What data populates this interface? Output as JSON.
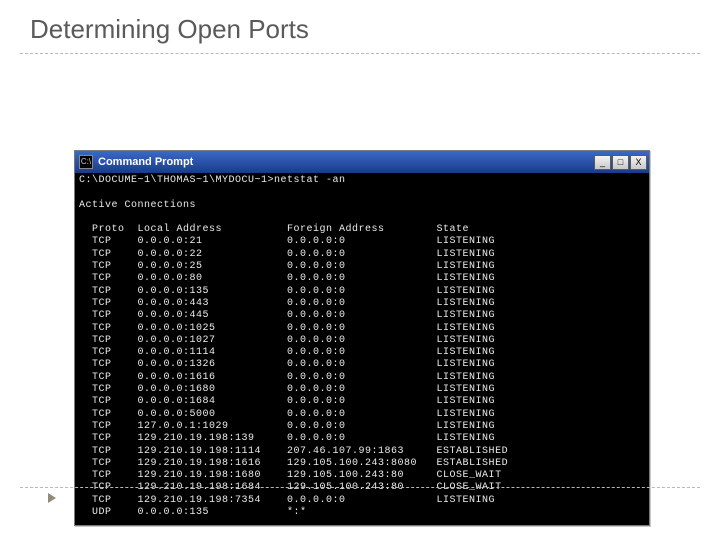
{
  "slide": {
    "title": "Determining Open Ports"
  },
  "window": {
    "title": "Command Prompt",
    "icon_text": "C:\\",
    "min_label": "_",
    "max_label": "□",
    "close_label": "X"
  },
  "terminal": {
    "prompt": "C:\\DOCUME~1\\THOMAS~1\\MYDOCU~1>netstat -an",
    "section_header": "Active Connections",
    "columns": {
      "proto": "Proto",
      "local": "Local Address",
      "foreign": "Foreign Address",
      "state": "State"
    },
    "rows": [
      {
        "proto": "TCP",
        "local": "0.0.0.0:21",
        "foreign": "0.0.0.0:0",
        "state": "LISTENING"
      },
      {
        "proto": "TCP",
        "local": "0.0.0.0:22",
        "foreign": "0.0.0.0:0",
        "state": "LISTENING"
      },
      {
        "proto": "TCP",
        "local": "0.0.0.0:25",
        "foreign": "0.0.0.0:0",
        "state": "LISTENING"
      },
      {
        "proto": "TCP",
        "local": "0.0.0.0:80",
        "foreign": "0.0.0.0:0",
        "state": "LISTENING"
      },
      {
        "proto": "TCP",
        "local": "0.0.0.0:135",
        "foreign": "0.0.0.0:0",
        "state": "LISTENING"
      },
      {
        "proto": "TCP",
        "local": "0.0.0.0:443",
        "foreign": "0.0.0.0:0",
        "state": "LISTENING"
      },
      {
        "proto": "TCP",
        "local": "0.0.0.0:445",
        "foreign": "0.0.0.0:0",
        "state": "LISTENING"
      },
      {
        "proto": "TCP",
        "local": "0.0.0.0:1025",
        "foreign": "0.0.0.0:0",
        "state": "LISTENING"
      },
      {
        "proto": "TCP",
        "local": "0.0.0.0:1027",
        "foreign": "0.0.0.0:0",
        "state": "LISTENING"
      },
      {
        "proto": "TCP",
        "local": "0.0.0.0:1114",
        "foreign": "0.0.0.0:0",
        "state": "LISTENING"
      },
      {
        "proto": "TCP",
        "local": "0.0.0.0:1326",
        "foreign": "0.0.0.0:0",
        "state": "LISTENING"
      },
      {
        "proto": "TCP",
        "local": "0.0.0.0:1616",
        "foreign": "0.0.0.0:0",
        "state": "LISTENING"
      },
      {
        "proto": "TCP",
        "local": "0.0.0.0:1680",
        "foreign": "0.0.0.0:0",
        "state": "LISTENING"
      },
      {
        "proto": "TCP",
        "local": "0.0.0.0:1684",
        "foreign": "0.0.0.0:0",
        "state": "LISTENING"
      },
      {
        "proto": "TCP",
        "local": "0.0.0.0:5000",
        "foreign": "0.0.0.0:0",
        "state": "LISTENING"
      },
      {
        "proto": "TCP",
        "local": "127.0.0.1:1029",
        "foreign": "0.0.0.0:0",
        "state": "LISTENING"
      },
      {
        "proto": "TCP",
        "local": "129.210.19.198:139",
        "foreign": "0.0.0.0:0",
        "state": "LISTENING"
      },
      {
        "proto": "TCP",
        "local": "129.210.19.198:1114",
        "foreign": "207.46.107.99:1863",
        "state": "ESTABLISHED"
      },
      {
        "proto": "TCP",
        "local": "129.210.19.198:1616",
        "foreign": "129.105.100.243:8080",
        "state": "ESTABLISHED"
      },
      {
        "proto": "TCP",
        "local": "129.210.19.198:1680",
        "foreign": "129.105.100.243:80",
        "state": "CLOSE_WAIT"
      },
      {
        "proto": "TCP",
        "local": "129.210.19.198:1684",
        "foreign": "129.105.100.243:80",
        "state": "CLOSE_WAIT"
      },
      {
        "proto": "TCP",
        "local": "129.210.19.198:7354",
        "foreign": "0.0.0.0:0",
        "state": "LISTENING"
      },
      {
        "proto": "UDP",
        "local": "0.0.0.0:135",
        "foreign": "*:*",
        "state": ""
      }
    ]
  }
}
